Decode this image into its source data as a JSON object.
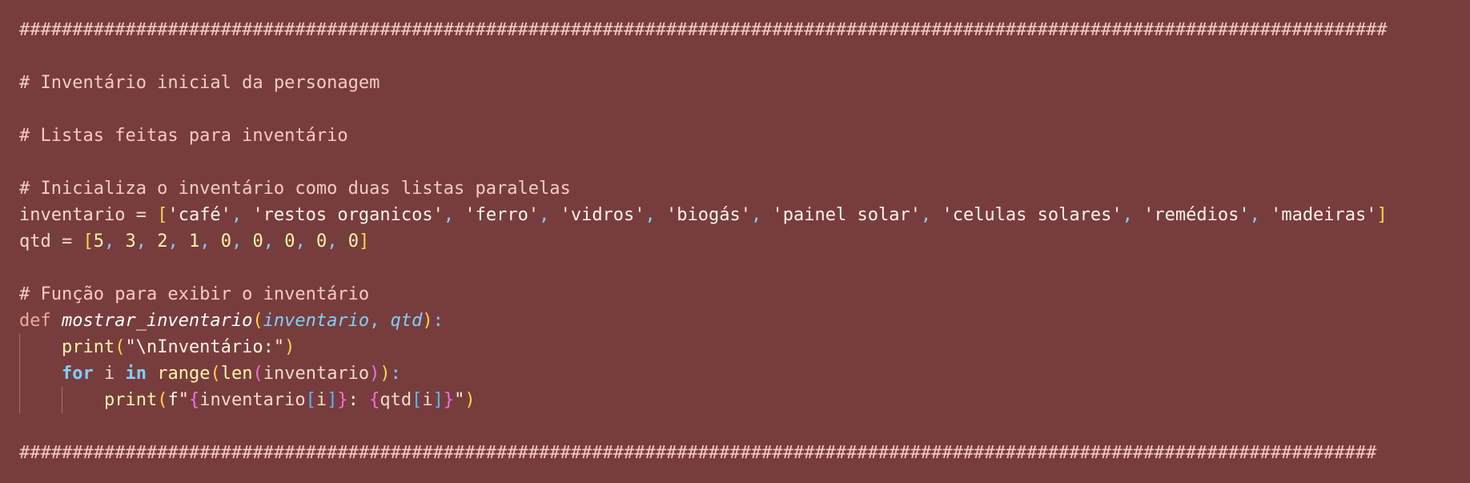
{
  "editor": {
    "colors": {
      "background": "#773d3d",
      "comment": "#f8c9c2",
      "keyword": "#f6a59a",
      "control": "#7fd0ff",
      "string": "#fff1e6",
      "number": "#fff1a8",
      "bracket1": "#ffd34d",
      "bracket2": "#ef6fe0",
      "bracket3": "#5fb4ff"
    },
    "lines": [
      {
        "indent": 0,
        "tokens": [
          {
            "text": "#################################################################################################################################",
            "type": "comment"
          }
        ]
      },
      {
        "indent": 0,
        "tokens": []
      },
      {
        "indent": 0,
        "tokens": [
          {
            "text": "# Inventário inicial da personagem",
            "type": "comment"
          }
        ]
      },
      {
        "indent": 0,
        "tokens": []
      },
      {
        "indent": 0,
        "tokens": [
          {
            "text": "# Listas feitas para inventário",
            "type": "comment"
          }
        ]
      },
      {
        "indent": 0,
        "tokens": []
      },
      {
        "indent": 0,
        "tokens": [
          {
            "text": "# Inicializa o inventário como duas listas paralelas",
            "type": "comment"
          }
        ]
      },
      {
        "indent": 0,
        "tokens": [
          {
            "text": "inventario",
            "type": "plain"
          },
          {
            "text": " = ",
            "type": "plain"
          },
          {
            "text": "[",
            "type": "bracket1"
          },
          {
            "text": "'café'",
            "type": "string"
          },
          {
            "text": ", ",
            "type": "punct"
          },
          {
            "text": "'restos organicos'",
            "type": "string"
          },
          {
            "text": ", ",
            "type": "punct"
          },
          {
            "text": "'ferro'",
            "type": "string"
          },
          {
            "text": ", ",
            "type": "punct"
          },
          {
            "text": "'vidros'",
            "type": "string"
          },
          {
            "text": ", ",
            "type": "punct"
          },
          {
            "text": "'biogás'",
            "type": "string"
          },
          {
            "text": ", ",
            "type": "punct"
          },
          {
            "text": "'painel solar'",
            "type": "string"
          },
          {
            "text": ", ",
            "type": "punct"
          },
          {
            "text": "'celulas solares'",
            "type": "string"
          },
          {
            "text": ", ",
            "type": "punct"
          },
          {
            "text": "'remédios'",
            "type": "string"
          },
          {
            "text": ", ",
            "type": "punct"
          },
          {
            "text": "'madeiras'",
            "type": "string"
          },
          {
            "text": "]",
            "type": "bracket1"
          }
        ]
      },
      {
        "indent": 0,
        "tokens": [
          {
            "text": "qtd",
            "type": "plain"
          },
          {
            "text": " = ",
            "type": "plain"
          },
          {
            "text": "[",
            "type": "bracket1"
          },
          {
            "text": "5",
            "type": "number"
          },
          {
            "text": ", ",
            "type": "punct"
          },
          {
            "text": "3",
            "type": "number"
          },
          {
            "text": ", ",
            "type": "punct"
          },
          {
            "text": "2",
            "type": "number"
          },
          {
            "text": ", ",
            "type": "punct"
          },
          {
            "text": "1",
            "type": "number"
          },
          {
            "text": ", ",
            "type": "punct"
          },
          {
            "text": "0",
            "type": "number"
          },
          {
            "text": ", ",
            "type": "punct"
          },
          {
            "text": "0",
            "type": "number"
          },
          {
            "text": ", ",
            "type": "punct"
          },
          {
            "text": "0",
            "type": "number"
          },
          {
            "text": ", ",
            "type": "punct"
          },
          {
            "text": "0",
            "type": "number"
          },
          {
            "text": ", ",
            "type": "punct"
          },
          {
            "text": "0",
            "type": "number"
          },
          {
            "text": "]",
            "type": "bracket1"
          }
        ]
      },
      {
        "indent": 0,
        "tokens": []
      },
      {
        "indent": 0,
        "tokens": [
          {
            "text": "# Função para exibir o inventário",
            "type": "comment"
          }
        ]
      },
      {
        "indent": 0,
        "tokens": [
          {
            "text": "def ",
            "type": "keyword"
          },
          {
            "text": "mostrar_inventario",
            "type": "fn-def"
          },
          {
            "text": "(",
            "type": "bracket1"
          },
          {
            "text": "inventario",
            "type": "param"
          },
          {
            "text": ", ",
            "type": "punct"
          },
          {
            "text": "qtd",
            "type": "param"
          },
          {
            "text": ")",
            "type": "bracket1"
          },
          {
            "text": ":",
            "type": "punct"
          }
        ]
      },
      {
        "indent": 1,
        "tokens": [
          {
            "text": "    ",
            "type": "plain"
          },
          {
            "text": "print",
            "type": "builtin"
          },
          {
            "text": "(",
            "type": "bracket1"
          },
          {
            "text": "\"\\nInventário:\"",
            "type": "string"
          },
          {
            "text": ")",
            "type": "bracket1"
          }
        ]
      },
      {
        "indent": 1,
        "tokens": [
          {
            "text": "    ",
            "type": "plain"
          },
          {
            "text": "for",
            "type": "control"
          },
          {
            "text": " i ",
            "type": "plain"
          },
          {
            "text": "in",
            "type": "control"
          },
          {
            "text": " ",
            "type": "plain"
          },
          {
            "text": "range",
            "type": "builtin"
          },
          {
            "text": "(",
            "type": "bracket1"
          },
          {
            "text": "len",
            "type": "builtin"
          },
          {
            "text": "(",
            "type": "bracket2"
          },
          {
            "text": "inventario",
            "type": "plain"
          },
          {
            "text": ")",
            "type": "bracket2"
          },
          {
            "text": ")",
            "type": "bracket1"
          },
          {
            "text": ":",
            "type": "punct"
          }
        ]
      },
      {
        "indent": 2,
        "tokens": [
          {
            "text": "        ",
            "type": "plain"
          },
          {
            "text": "print",
            "type": "builtin"
          },
          {
            "text": "(",
            "type": "bracket1"
          },
          {
            "text": "f\"",
            "type": "string"
          },
          {
            "text": "{",
            "type": "bracket2"
          },
          {
            "text": "inventario",
            "type": "plain"
          },
          {
            "text": "[",
            "type": "bracket3"
          },
          {
            "text": "i",
            "type": "plain"
          },
          {
            "text": "]",
            "type": "bracket3"
          },
          {
            "text": "}",
            "type": "bracket2"
          },
          {
            "text": ": ",
            "type": "string"
          },
          {
            "text": "{",
            "type": "bracket2"
          },
          {
            "text": "qtd",
            "type": "plain"
          },
          {
            "text": "[",
            "type": "bracket3"
          },
          {
            "text": "i",
            "type": "plain"
          },
          {
            "text": "]",
            "type": "bracket3"
          },
          {
            "text": "}",
            "type": "bracket2"
          },
          {
            "text": "\"",
            "type": "string"
          },
          {
            "text": ")",
            "type": "bracket1"
          }
        ]
      },
      {
        "indent": 0,
        "tokens": []
      },
      {
        "indent": 0,
        "tokens": [
          {
            "text": "################################################################################################################################",
            "type": "comment"
          }
        ]
      }
    ]
  }
}
